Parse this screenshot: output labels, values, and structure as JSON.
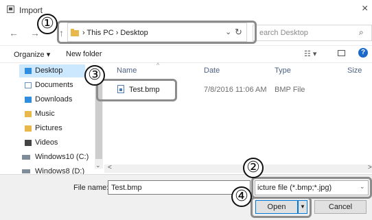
{
  "window": {
    "title": "Import",
    "close_glyph": "×"
  },
  "nav": {
    "back_glyph": "←",
    "forward_glyph": "→",
    "up_glyph": "↑",
    "breadcrumb": "›  This PC  ›  Desktop",
    "dropdown_glyph": "⌄",
    "refresh_glyph": "↻",
    "search_placeholder": "earch Desktop",
    "search_glyph": "⌕"
  },
  "commands": {
    "organize": "Organize ▾",
    "new_folder": "New folder",
    "view_glyph": "☷  ▾",
    "help_glyph": "?"
  },
  "sidebar": {
    "items": [
      {
        "label": "Desktop",
        "icon": "folder-icon",
        "color": "#2f8fde"
      },
      {
        "label": "Documents",
        "icon": "documents-icon",
        "color": "#6b8fb8"
      },
      {
        "label": "Downloads",
        "icon": "downloads-icon",
        "color": "#2f8fde"
      },
      {
        "label": "Music",
        "icon": "music-icon",
        "color": "#e8b84a"
      },
      {
        "label": "Pictures",
        "icon": "pictures-icon",
        "color": "#e8b84a"
      },
      {
        "label": "Videos",
        "icon": "videos-icon",
        "color": "#444444"
      },
      {
        "label": "Windows10 (C:)",
        "icon": "drive-icon",
        "color": "#7f8c99"
      },
      {
        "label": "Windows8 (D:)",
        "icon": "drive-icon",
        "color": "#7f8c99"
      }
    ],
    "down_glyph": "⌄"
  },
  "columns": {
    "name": "Name",
    "date": "Date",
    "type": "Type",
    "size": "Size",
    "sort_glyph": "^"
  },
  "files": [
    {
      "name": "Test.bmp",
      "date": "7/8/2016 11:06 AM",
      "type": "BMP File"
    }
  ],
  "hscroll": {
    "left_glyph": "<",
    "right_glyph": ">"
  },
  "footer": {
    "file_name_label": "File name:",
    "file_name_value": "Test.bmp",
    "filter_text": "icture file (*.bmp;*.jpg)",
    "filter_glyph": "⌄",
    "open_label": "Open",
    "split_glyph": "▼",
    "cancel_label": "Cancel"
  },
  "callouts": [
    "①",
    "②",
    "③",
    "④"
  ],
  "colors": {
    "selection": "#cce8ff",
    "accent": "#0078d7",
    "callout_border": "#8c8c8c"
  }
}
